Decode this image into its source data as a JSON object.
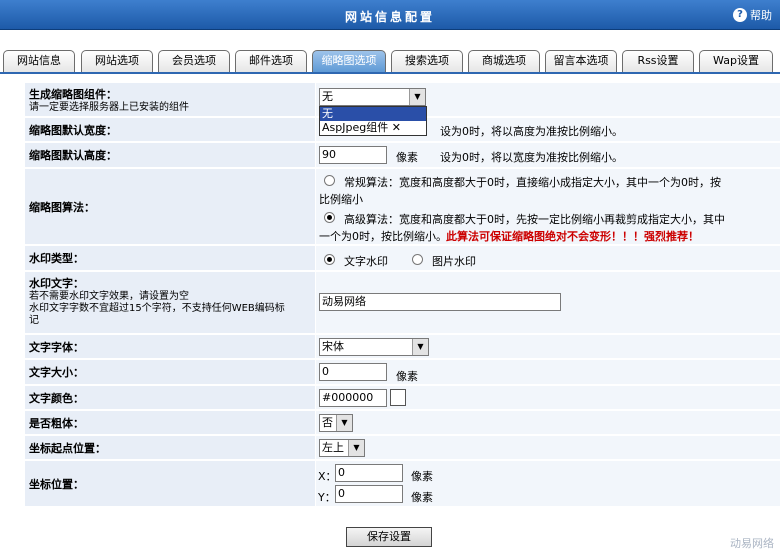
{
  "header": {
    "title": "网站信息配置",
    "help_label": "帮助"
  },
  "tabs": [
    "网站信息",
    "网站选项",
    "会员选项",
    "邮件选项",
    "缩略图选项",
    "搜索选项",
    "商城选项",
    "留言本选项",
    "Rss设置",
    "Wap设置"
  ],
  "active_tab": "缩略图选项",
  "form": {
    "component": {
      "label": "生成缩略图组件：",
      "note": "请一定要选择服务器上已安装的组件",
      "value": "无",
      "options": [
        "无",
        "AspJpeg组件 ✕"
      ]
    },
    "width": {
      "label": "缩略图默认宽度：",
      "hint": "设为0时，将以高度为准按比例缩小。"
    },
    "height": {
      "label": "缩略图默认高度：",
      "value": "90",
      "unit": "像素",
      "hint": "设为0时，将以宽度为准按比例缩小。"
    },
    "algo": {
      "label": "缩略图算法：",
      "opt1_line1": "常规算法：宽度和高度都大于0时，直接缩小成指定大小，其中一个为0时，按",
      "opt1_line2": "比例缩小",
      "opt2_line1": "高级算法：宽度和高度都大于0时，先按一定比例缩小再裁剪成指定大小，其中",
      "opt2_line2_a": "一个为0时，按比例缩小。",
      "opt2_line2_b": "此算法可保证缩略图绝对不会变形！！！强烈推荐！"
    },
    "watermark_type": {
      "label": "水印类型：",
      "opt_text": "文字水印",
      "opt_image": "图片水印"
    },
    "watermark_text": {
      "label": "水印文字：",
      "note1": "若不需要水印文字效果，请设置为空",
      "note2": "水印文字字数不宜超过15个字符，不支持任何WEB编码标",
      "note3": "记",
      "value": "动易网络"
    },
    "font": {
      "label": "文字字体：",
      "value": "宋体"
    },
    "font_size": {
      "label": "文字大小：",
      "value": "0",
      "unit": "像素"
    },
    "font_color": {
      "label": "文字颜色：",
      "value": "#000000"
    },
    "bold": {
      "label": "是否粗体：",
      "value": "否"
    },
    "origin": {
      "label": "坐标起点位置：",
      "value": "左上"
    },
    "position": {
      "label": "坐标位置：",
      "x_label": "X：",
      "x_value": "0",
      "y_label": "Y：",
      "y_value": "0",
      "unit": "像素"
    }
  },
  "save_label": "保存设置",
  "watermark_label": "动易网络"
}
